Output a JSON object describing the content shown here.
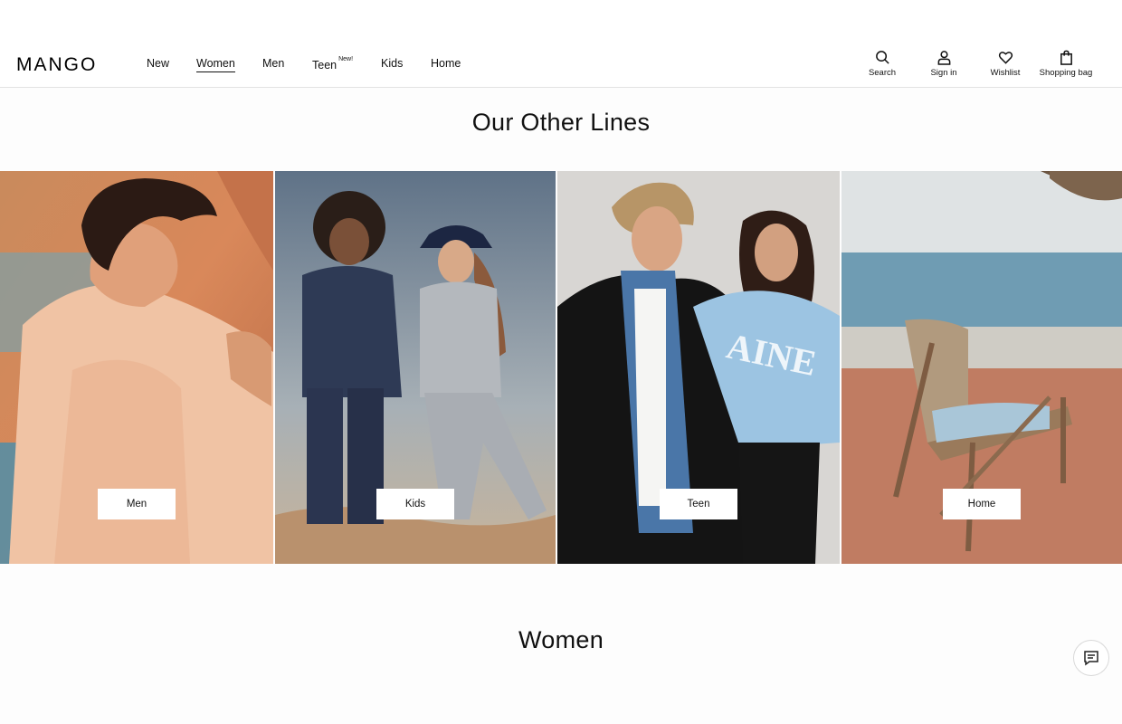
{
  "brand": {
    "logo": "MANGO"
  },
  "nav": {
    "items": [
      {
        "label": "New",
        "badge": ""
      },
      {
        "label": "Women",
        "badge": "",
        "active": true
      },
      {
        "label": "Men",
        "badge": ""
      },
      {
        "label": "Teen",
        "badge": "New!"
      },
      {
        "label": "Kids",
        "badge": ""
      },
      {
        "label": "Home",
        "badge": ""
      }
    ]
  },
  "tools": {
    "search": {
      "label": "Search",
      "icon": "search-icon"
    },
    "signin": {
      "label": "Sign in",
      "icon": "user-icon"
    },
    "wishlist": {
      "label": "Wishlist",
      "icon": "heart-icon"
    },
    "bag": {
      "label": "Shopping bag",
      "icon": "bag-icon"
    }
  },
  "other_lines": {
    "title": "Our Other Lines",
    "tiles": [
      {
        "label": "Men"
      },
      {
        "label": "Kids"
      },
      {
        "label": "Teen"
      },
      {
        "label": "Home"
      }
    ]
  },
  "women": {
    "title": "Women"
  },
  "chat": {
    "icon": "chat-icon"
  }
}
